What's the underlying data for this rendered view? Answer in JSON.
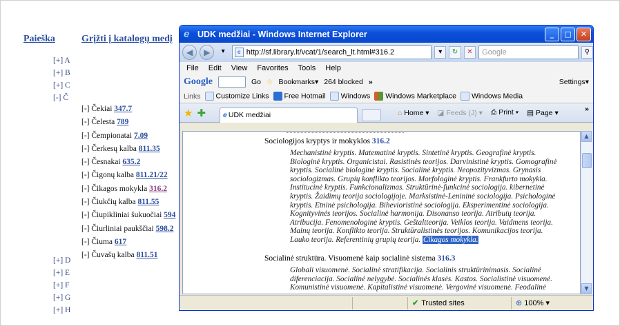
{
  "catalog": {
    "search_link": "Paieška",
    "back_link": "Grįžti į katalogų medį",
    "letters_top": [
      "[+] A",
      "[+] B",
      "[+] C",
      "[-] Č"
    ],
    "letters_bottom": [
      "[+] D",
      "[+] E",
      "[+] F",
      "[+] G",
      "[+] H"
    ],
    "sub_items": [
      {
        "label": "[-] Čekiai ",
        "code": "347.7",
        "visited": false
      },
      {
        "label": "[-] Čelesta ",
        "code": "789",
        "visited": false
      },
      {
        "label": "[-] Čempionatai ",
        "code": "7.09",
        "visited": false
      },
      {
        "label": "[-] Čerkesų kalba ",
        "code": "811.35",
        "visited": false
      },
      {
        "label": "[-] Česnakai ",
        "code": "635.2",
        "visited": false
      },
      {
        "label": "[-] Čigonų kalba ",
        "code": "811.21/22",
        "visited": false
      },
      {
        "label": "[-] Čikagos mokykla ",
        "code": "316.2",
        "visited": true
      },
      {
        "label": "[-] Čiukčių kalba ",
        "code": "811.55",
        "visited": false
      },
      {
        "label": "[-] Čiupikliniai šukuočiai ",
        "code": "594",
        "visited": false
      },
      {
        "label": "[-] Čiurliniai paukščiai ",
        "code": "598.2",
        "visited": false
      },
      {
        "label": "[-] Čiuma ",
        "code": "617",
        "visited": false
      },
      {
        "label": "[-] Čuvašų kalba ",
        "code": "811.51",
        "visited": false
      }
    ]
  },
  "browser": {
    "title": "UDK medžiai - Windows Internet Explorer",
    "address": "http://sf.library.lt/vcat/1/search_lt.html#316.2",
    "search_placeholder": "Google",
    "menu": [
      "File",
      "Edit",
      "View",
      "Favorites",
      "Tools",
      "Help"
    ],
    "google_bar": {
      "logo": "Google",
      "go": "Go",
      "bookmarks": "Bookmarks▾",
      "blocked": "264 blocked",
      "more": "»",
      "settings": "Settings▾"
    },
    "links_bar": {
      "label": "Links",
      "items": [
        "Customize Links",
        "Free Hotmail",
        "Windows",
        "Windows Marketplace",
        "Windows Media"
      ]
    },
    "tab_label": "UDK medžiai",
    "commands": {
      "home": "Home",
      "feeds": "Feeds (J)",
      "print": "Print",
      "page": "Page"
    },
    "status": {
      "zone": "Trusted sites",
      "zoom": "100%"
    },
    "colors": {
      "titlebar": "#0a4ed8",
      "highlight": "#3165c6"
    }
  },
  "content": {
    "section1_title": "Sociologijos kryptys ir mokyklos ",
    "section1_code": "316.2",
    "section1_lines": [
      "Mechanistinė kryptis. Matematinė kryptis. Sintetinė kryptis. Geografinė kryptis.",
      "Biologinė kryptis. Organicistai. Rasistinės teorijos. Darvinistinė kryptis. Gomografinė",
      "kryptis. Socialinė biologinė kryptis. Socialinė kryptis. Neopozityvizmas. Grynasis",
      "sociologizmas. Grupių konflikto teorijos. Morfologinė kryptis. Frankfurto mokykla.",
      "Institucinė kryptis. Funkcionalizmas. Struktūrinė-funkcinė sociologija. kibernetinė",
      "kryptis. Žaidimų teorija sociologijoje. Marksistinė-Lenininė sociologija. Psichologinė",
      "kryptis. Etninė psichologija. Bihevioristinė sociologija. Eksperimentinė sociologija.",
      "Kognityvinės teorijos. Socialinė harmonija. Disonanso teorija. Atributų teorija.",
      "Atribucija. Fenomenologinė kryptis. Geštaltteorija. Veiklos teorija. Vaidmens teorija.",
      "Mainų teorija. Konflikto teorija. Struktūralistinės teorijos. Komunikacijos teorija."
    ],
    "section1_last": "Lauko teorija. Referentinių grupių teorija. ",
    "section1_highlight": "Čikagos mokykla.",
    "section2_title": "Socialinė struktūra. Visuomenė kaip socialinė sistema ",
    "section2_code": "316.3",
    "section2_lines": [
      "Globali visuomenė. Socialinė stratifikacija. Socialinis struktūrinimasis. Socialinė",
      "diferenciacija. Socialinė nelygybė. Socialinės klasės. Kastos. Socialistinė visuomenė.",
      "Komunistinė visuomenė. Kapitalistinė visuomenė. Vergovinė visuomenė. Feodalinė"
    ]
  }
}
